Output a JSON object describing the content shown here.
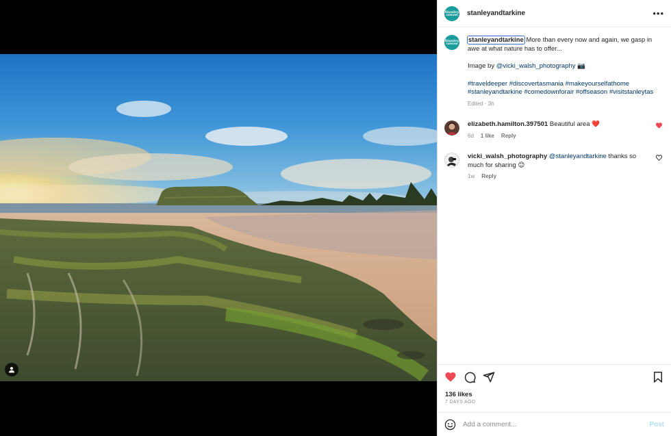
{
  "account": {
    "username": "stanleyandtarkine",
    "logo_line1": "Stanley",
    "logo_line2": "TARKINE"
  },
  "caption": {
    "username": "stanleyandtarkine",
    "text_line": "More than every now and again, we gasp in awe at what nature has to offer...",
    "credit_prefix": "Image by",
    "credit_handle": "@vicki_walsh_photography",
    "credit_suffix": "📷",
    "hashtags": "#traveldeeper #discovertasmania #makeyourselfathome #stanleyandtarkine #comedownforair #offseason #visitstanleytas",
    "meta": "Edited · 3h"
  },
  "comments": [
    {
      "username": "elizabeth.hamilton.397501",
      "text": "Beautiful area ❤️",
      "time": "6d",
      "likes": "1 like",
      "reply_label": "Reply",
      "liked": true
    },
    {
      "username": "vicki_walsh_photography",
      "mention": "@stanleyandtarkine",
      "text": "thanks so much for sharing 😊",
      "time": "1w",
      "reply_label": "Reply",
      "liked": false
    }
  ],
  "post": {
    "likes": "136 likes",
    "date": "7 DAYS AGO"
  },
  "composer": {
    "placeholder": "Add a comment...",
    "post_label": "Post"
  },
  "colors": {
    "brand_teal": "#1a9c9c",
    "like_red": "#ed4956",
    "link_blue": "#00376b",
    "post_disabled": "#b2dffc"
  },
  "icons": {
    "tag": "user-tag-icon",
    "more": "more-options-icon",
    "like": "heart-filled-icon",
    "comment": "comment-icon",
    "share": "share-icon",
    "save": "bookmark-icon",
    "emoji": "emoji-icon"
  }
}
